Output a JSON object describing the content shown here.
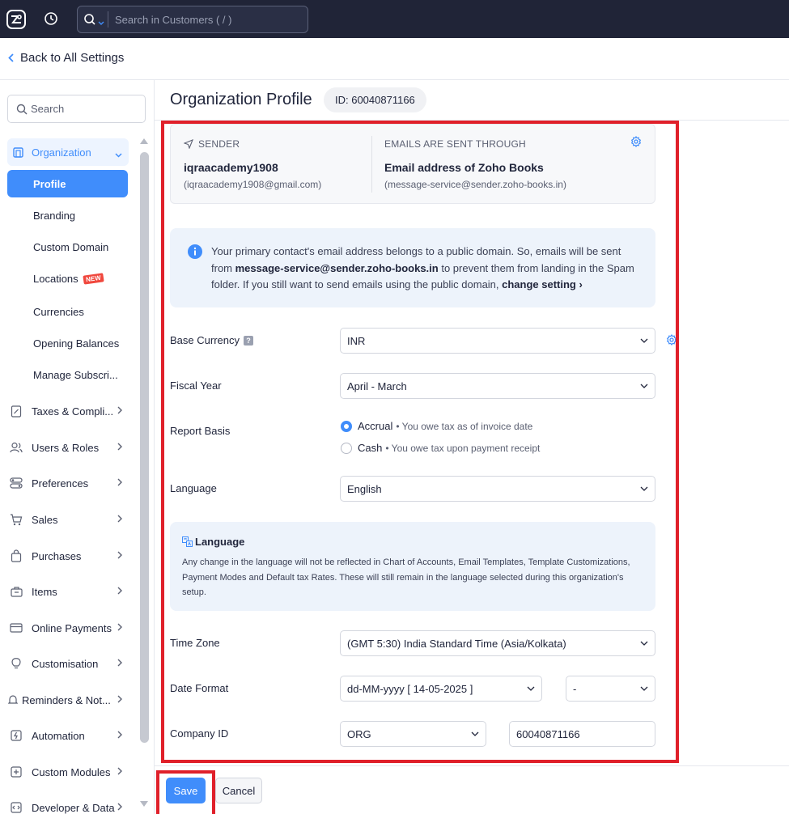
{
  "topbar": {
    "search_placeholder": "Search in Customers ( / )"
  },
  "back_link": "Back to All Settings",
  "sidebar": {
    "search_placeholder": "Search",
    "organization_label": "Organization",
    "sub_items": [
      {
        "label": "Profile",
        "active": true
      },
      {
        "label": "Branding"
      },
      {
        "label": "Custom Domain"
      },
      {
        "label": "Locations",
        "badge": "NEW"
      },
      {
        "label": "Currencies"
      },
      {
        "label": "Opening Balances"
      },
      {
        "label": "Manage Subscri..."
      }
    ],
    "nav_items": [
      {
        "label": "Taxes & Compli...",
        "icon": "tax-icon"
      },
      {
        "label": "Users & Roles",
        "icon": "users-icon"
      },
      {
        "label": "Preferences",
        "icon": "preferences-icon"
      },
      {
        "label": "Sales",
        "icon": "cart-icon"
      },
      {
        "label": "Purchases",
        "icon": "bag-icon"
      },
      {
        "label": "Items",
        "icon": "items-icon"
      },
      {
        "label": "Online Payments",
        "icon": "card-icon"
      },
      {
        "label": "Customisation",
        "icon": "bulb-icon"
      },
      {
        "label": "Reminders & Not...",
        "icon": "bell-icon"
      },
      {
        "label": "Automation",
        "icon": "lightning-icon"
      },
      {
        "label": "Custom Modules",
        "icon": "modules-icon"
      },
      {
        "label": "Developer & Data",
        "icon": "code-icon"
      }
    ]
  },
  "page": {
    "title": "Organization Profile",
    "org_id": "ID: 60040871166"
  },
  "sender_card": {
    "sender_caption": "SENDER",
    "sender_name": "iqraacademy1908",
    "sender_email": "(iqraacademy1908@gmail.com)",
    "through_caption": "EMAILS ARE SENT THROUGH",
    "through_name": "Email address of Zoho Books",
    "through_email": "(message-service@sender.zoho-books.in)"
  },
  "info_box": {
    "text_1": "Your primary contact's email address belongs to a public domain. So, emails will be sent from ",
    "bold_email": "message-service@sender.zoho-books.in",
    "text_2": " to prevent them from landing in the Spam folder. If you still want to send emails using the public domain, ",
    "link": "change setting ›"
  },
  "form": {
    "base_currency_label": "Base Currency",
    "base_currency_value": "INR",
    "fiscal_year_label": "Fiscal Year",
    "fiscal_year_value": "April - March",
    "report_basis_label": "Report Basis",
    "accrual_label": "Accrual",
    "accrual_note": "• You owe tax as of invoice date",
    "cash_label": "Cash",
    "cash_note": "• You owe tax upon payment receipt",
    "report_basis_selected": "Accrual",
    "language_label": "Language",
    "language_value": "English",
    "time_zone_label": "Time Zone",
    "time_zone_value": "(GMT 5:30) India Standard Time (Asia/Kolkata)",
    "date_format_label": "Date Format",
    "date_format_value": "dd-MM-yyyy [ 14-05-2025 ]",
    "date_separator_value": "-",
    "company_id_label": "Company ID",
    "company_id_type": "ORG",
    "company_id_value": "60040871166"
  },
  "language_note": {
    "title": "Language",
    "text": "Any change in the language will not be reflected in Chart of Accounts, Email Templates, Template Customizations, Payment Modes and Default tax Rates. These will still remain in the language selected during this organization's setup."
  },
  "footer": {
    "save_label": "Save",
    "cancel_label": "Cancel"
  },
  "colors": {
    "accent": "#408dfb",
    "topbar": "#202437",
    "highlight_frame": "#e0202a"
  }
}
